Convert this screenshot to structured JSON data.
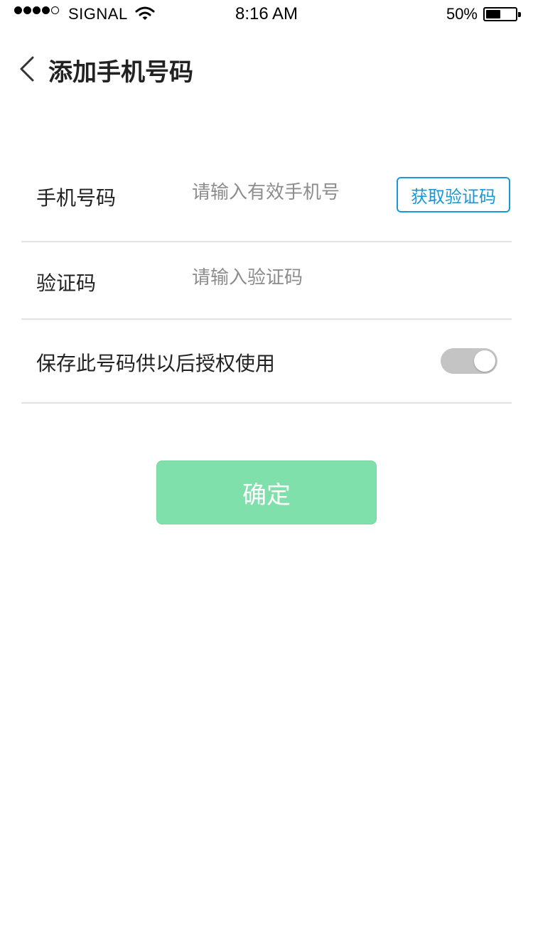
{
  "status_bar": {
    "carrier": "SIGNAL",
    "time": "8:16 AM",
    "battery_text": "50%",
    "battery_level": 0.5,
    "signal_bars": [
      true,
      true,
      true,
      true,
      false
    ]
  },
  "nav": {
    "title": "添加手机号码",
    "back_icon": "chevron-left-icon"
  },
  "form": {
    "phone": {
      "label": "手机号码",
      "placeholder": "请输入有效手机号",
      "value": "",
      "get_code_label": "获取验证码"
    },
    "code": {
      "label": "验证码",
      "placeholder": "请输入验证码",
      "value": ""
    },
    "save": {
      "label": "保存此号码供以后授权使用",
      "toggle_on": false
    }
  },
  "confirm": {
    "label": "确定"
  },
  "colors": {
    "accent_blue": "#1a97d6",
    "confirm_green": "#80e0ab",
    "toggle_off": "#c4c4c4",
    "divider": "#e2e2e2"
  }
}
